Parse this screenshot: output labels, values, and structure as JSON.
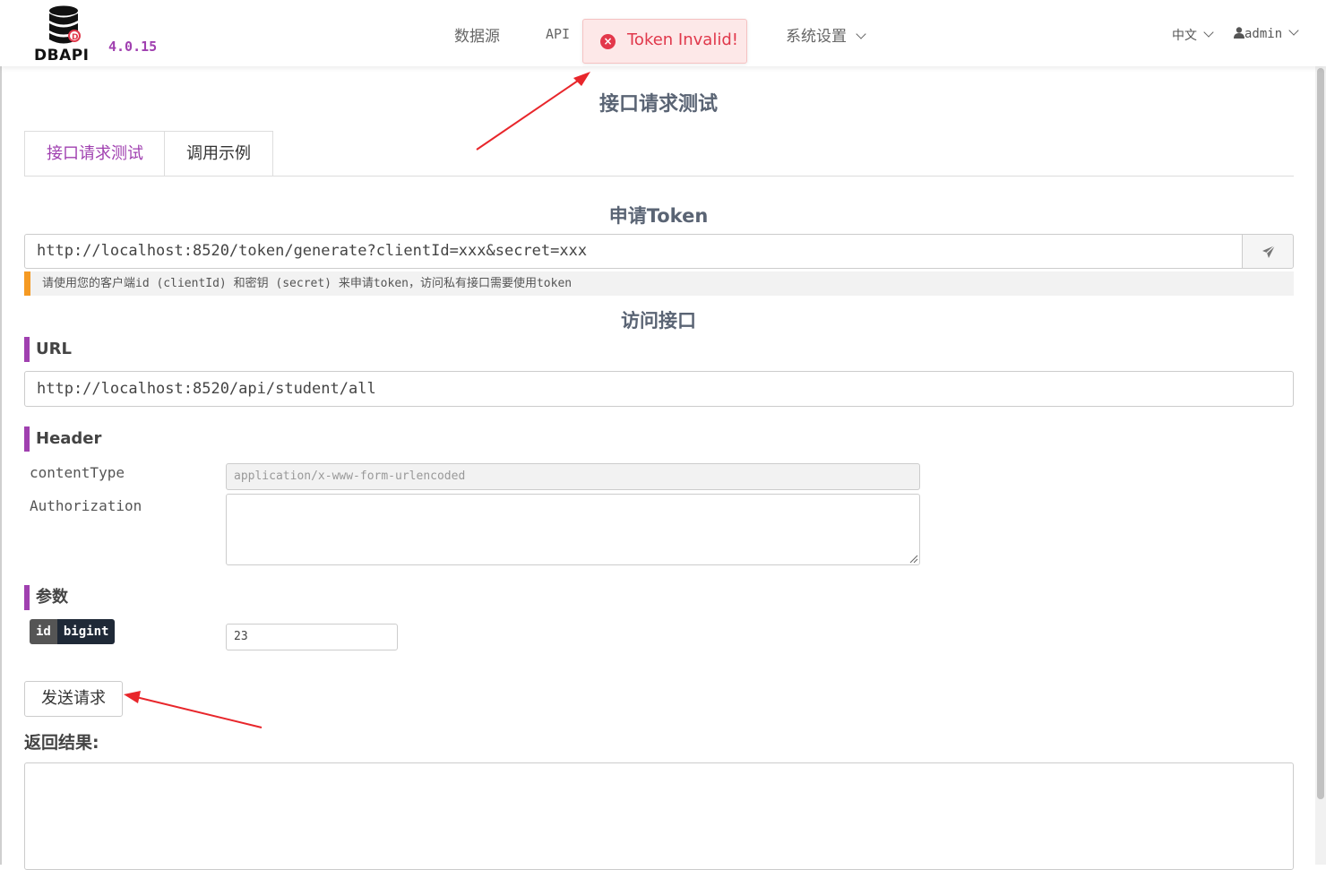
{
  "app": {
    "logo_text": "DBAPI",
    "version": "4.0.15"
  },
  "nav": {
    "datasource": "数据源",
    "api": "API",
    "settings": "系统设置",
    "language": "中文",
    "user": "admin"
  },
  "toast": {
    "message": "Token Invalid!"
  },
  "page": {
    "title": "接口请求测试",
    "tabs": [
      {
        "label": "接口请求测试",
        "active": true
      },
      {
        "label": "调用示例",
        "active": false
      }
    ]
  },
  "token": {
    "title": "申请Token",
    "url": "http://localhost:8520/token/generate?clientId=xxx&secret=xxx",
    "note": "请使用您的客户端id (clientId) 和密钥 (secret) 来申请token，访问私有接口需要使用token"
  },
  "access": {
    "title": "访问接口",
    "url_label": "URL",
    "url": "http://localhost:8520/api/student/all",
    "header_label": "Header",
    "content_type_label": "contentType",
    "content_type_value": "application/x-www-form-urlencoded",
    "authorization_label": "Authorization",
    "authorization_value": "",
    "params_label": "参数",
    "param_name": "id",
    "param_type": "bigint",
    "param_value": "23",
    "send_button": "发送请求",
    "result_label": "返回结果:"
  },
  "colors": {
    "accent": "#a040b0",
    "error": "#e0384b",
    "warning_bar": "#f59a23"
  }
}
